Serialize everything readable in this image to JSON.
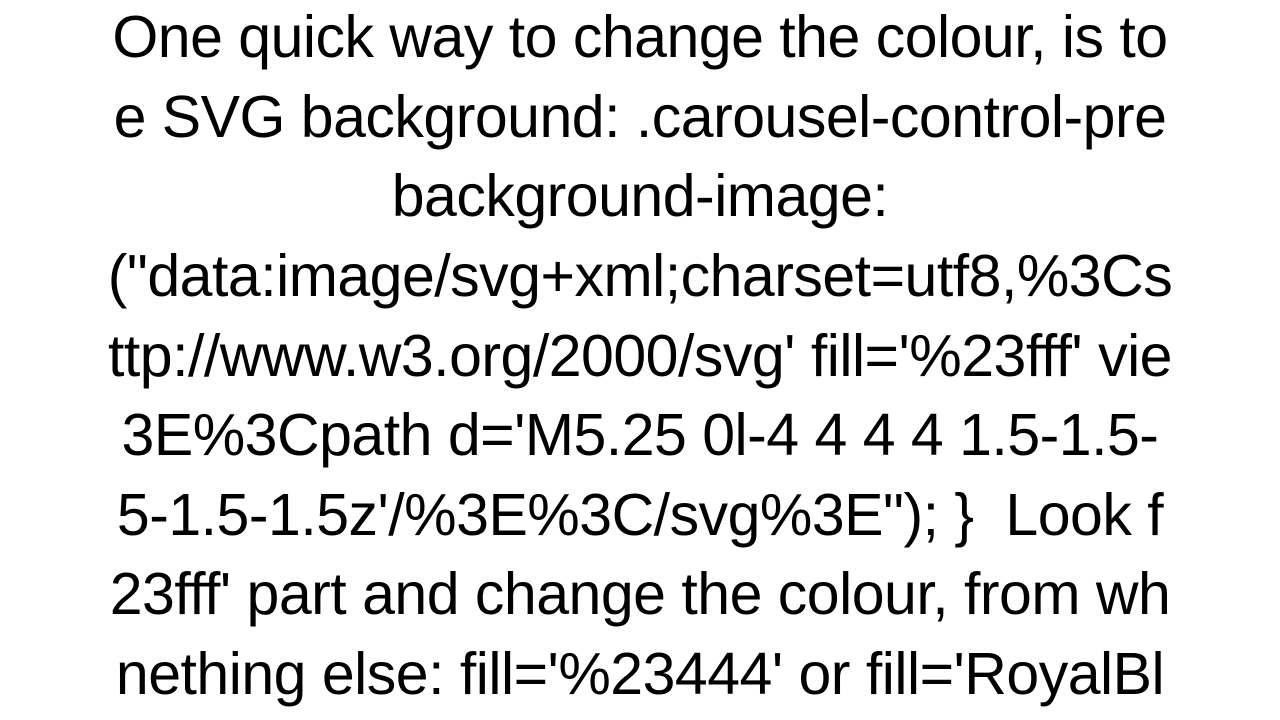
{
  "document": {
    "lines": [
      "One quick way to change the colour, is to",
      "e SVG background: .carousel-control-pre",
      "background-image:",
      "(\"data:image/svg+xml;charset=utf8,%3Cs",
      "ttp://www.w3.org/2000/svg' fill='%23fff' vie",
      "3E%3Cpath d='M5.25 0l-4 4 4 4 1.5-1.5-",
      "5-1.5-1.5z'/%3E%3C/svg%3E\"); }  Look f",
      "23fff' part and change the colour, from wh",
      "nething else: fill='%23444' or fill='RoyalBl"
    ]
  }
}
